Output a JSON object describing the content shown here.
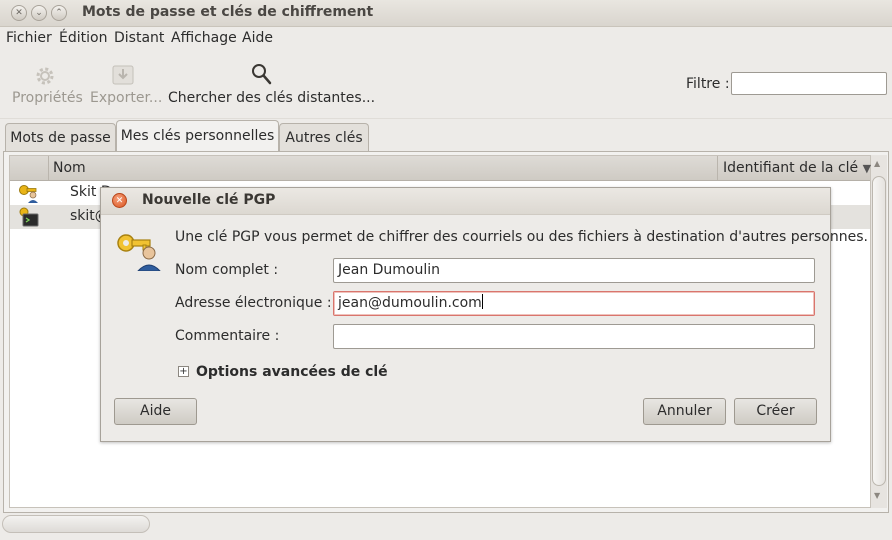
{
  "window": {
    "title": "Mots de passe et clés de chiffrement"
  },
  "menubar": [
    "Fichier",
    "Édition",
    "Distant",
    "Affichage",
    "Aide"
  ],
  "toolbar": {
    "properties_label": "Propriétés",
    "export_label": "Exporter...",
    "search_remote_label": "Chercher des clés distantes...",
    "filter_label": "Filtre :",
    "filter_value": ""
  },
  "tabs": [
    "Mots de passe",
    "Mes clés personnelles",
    "Autres clés"
  ],
  "active_tab": "Mes clés personnelles",
  "list": {
    "columns": [
      "Nom",
      "Identifiant de la clé"
    ],
    "sort_indicator": "▼",
    "rows": [
      {
        "icon": "key-person-icon",
        "name": "Skit D"
      },
      {
        "icon": "terminal-key-icon",
        "name": "skit@"
      }
    ]
  },
  "dialog": {
    "title": "Nouvelle clé PGP",
    "description": "Une clé PGP vous permet de chiffrer des courriels ou des fichiers à destination d'autres personnes.",
    "full_name_label": "Nom complet :",
    "full_name_value": "Jean Dumoulin",
    "email_label": "Adresse électronique :",
    "email_value": "jean@dumoulin.com",
    "comment_label": "Commentaire :",
    "comment_value": "",
    "advanced_label": "Options avancées de clé",
    "help_button": "Aide",
    "cancel_button": "Annuler",
    "create_button": "Créer"
  }
}
